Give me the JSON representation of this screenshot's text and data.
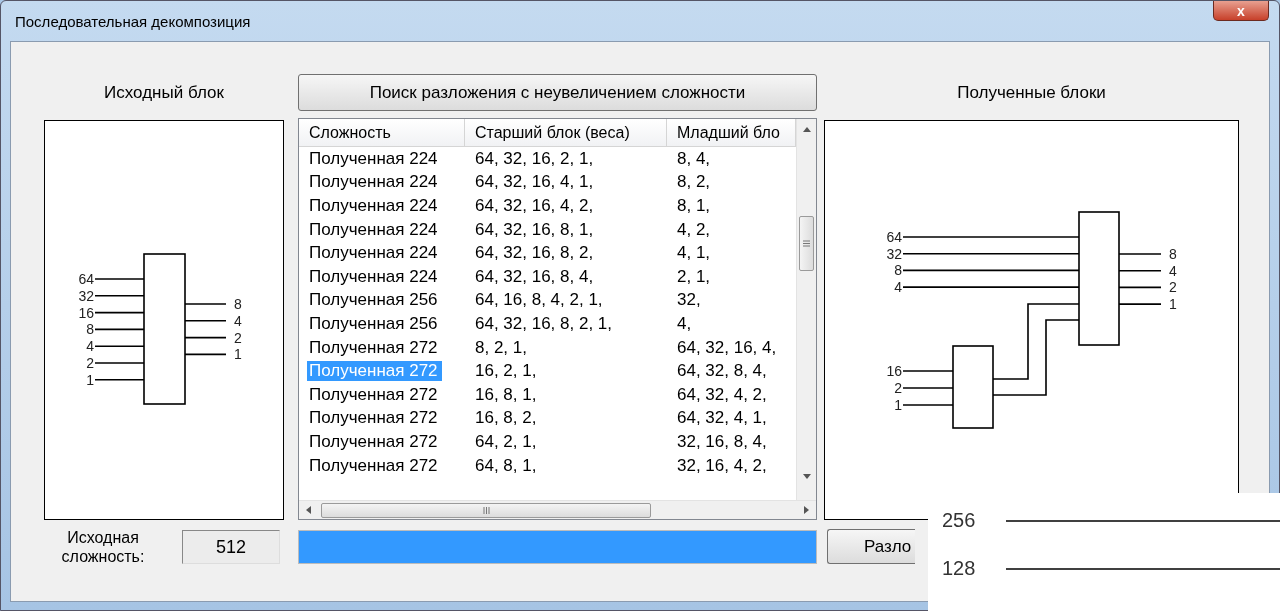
{
  "window": {
    "title": "Последовательная декомпозиция",
    "close_glyph": "x"
  },
  "source": {
    "title": "Исходный блок",
    "inputs": [
      "64",
      "32",
      "16",
      "8",
      "4",
      "2",
      "1"
    ],
    "outputs": [
      "8",
      "4",
      "2",
      "1"
    ],
    "complexity_label": "Исходная сложность:",
    "complexity_value": "512"
  },
  "search_button": "Поиск разложения с неувеличением сложности",
  "table": {
    "columns": [
      "Сложность",
      "Старший блок (веса)",
      "Младший бло"
    ],
    "rows": [
      {
        "cells": [
          "Полученная 224",
          "64, 32, 16, 2, 1,",
          "8, 4,"
        ],
        "selected": false
      },
      {
        "cells": [
          "Полученная 224",
          "64, 32, 16, 4, 1,",
          "8, 2,"
        ],
        "selected": false
      },
      {
        "cells": [
          "Полученная 224",
          "64, 32, 16, 4, 2,",
          "8, 1,"
        ],
        "selected": false
      },
      {
        "cells": [
          "Полученная 224",
          "64, 32, 16, 8, 1,",
          "4, 2,"
        ],
        "selected": false
      },
      {
        "cells": [
          "Полученная 224",
          "64, 32, 16, 8, 2,",
          "4, 1,"
        ],
        "selected": false
      },
      {
        "cells": [
          "Полученная 224",
          "64, 32, 16, 8, 4,",
          "2, 1,"
        ],
        "selected": false
      },
      {
        "cells": [
          "Полученная 256",
          "64, 16, 8, 4, 2, 1,",
          "32,"
        ],
        "selected": false
      },
      {
        "cells": [
          "Полученная 256",
          "64, 32, 16, 8, 2, 1,",
          "4,"
        ],
        "selected": false
      },
      {
        "cells": [
          "Полученная 272",
          "8, 2, 1,",
          "64, 32, 16, 4,"
        ],
        "selected": false
      },
      {
        "cells": [
          "Полученная 272",
          "16, 2, 1,",
          "64, 32, 8, 4,"
        ],
        "selected": true
      },
      {
        "cells": [
          "Полученная 272",
          "16, 8, 1,",
          "64, 32, 4, 2,"
        ],
        "selected": false
      },
      {
        "cells": [
          "Полученная 272",
          "16, 8, 2,",
          "64, 32, 4, 1,"
        ],
        "selected": false
      },
      {
        "cells": [
          "Полученная 272",
          "64, 2, 1,",
          "32, 16, 8, 4,"
        ],
        "selected": false
      },
      {
        "cells": [
          "Полученная 272",
          "64, 8, 1,",
          "32, 16, 4, 2,"
        ],
        "selected": false
      }
    ]
  },
  "progress": {
    "level": 1
  },
  "result": {
    "title": "Полученные блоки",
    "main_inputs": [
      "64",
      "32",
      "8",
      "4"
    ],
    "outputs": [
      "8",
      "4",
      "2",
      "1"
    ],
    "sub_inputs": [
      "16",
      "2",
      "1"
    ],
    "button": "Разло"
  },
  "overlay": {
    "labels": [
      "256",
      "128"
    ]
  }
}
